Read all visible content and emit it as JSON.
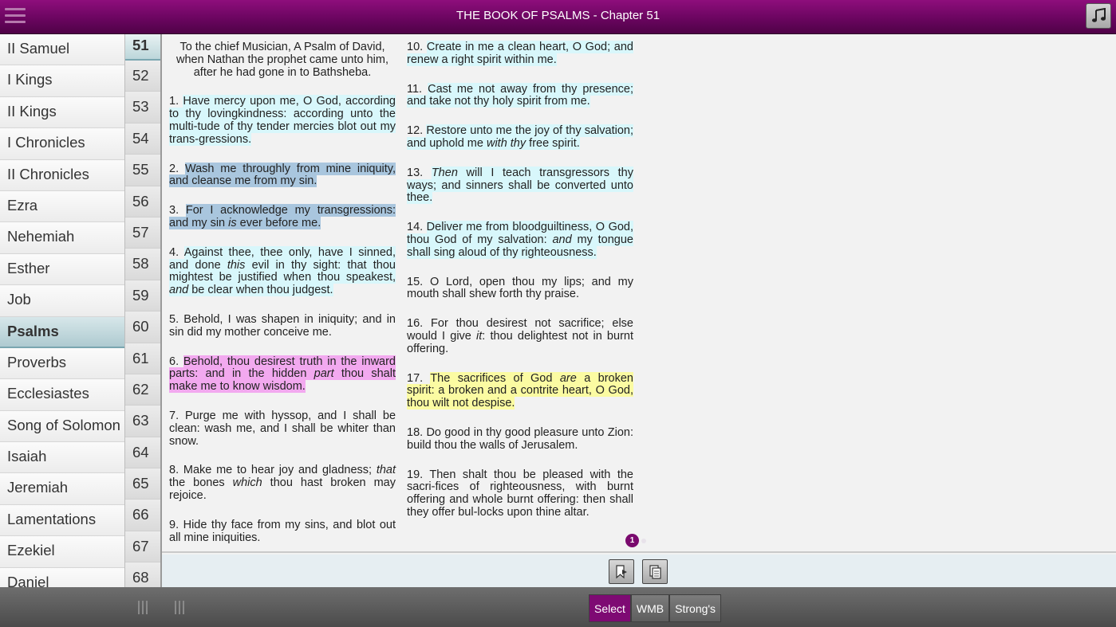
{
  "header": {
    "title": "THE BOOK OF PSALMS - Chapter 51"
  },
  "books": [
    {
      "label": "II Samuel"
    },
    {
      "label": "I Kings"
    },
    {
      "label": "II Kings"
    },
    {
      "label": "I Chronicles"
    },
    {
      "label": "II Chronicles"
    },
    {
      "label": "Ezra"
    },
    {
      "label": "Nehemiah"
    },
    {
      "label": "Esther"
    },
    {
      "label": "Job"
    },
    {
      "label": "Psalms",
      "selected": true
    },
    {
      "label": "Proverbs"
    },
    {
      "label": "Ecclesiastes"
    },
    {
      "label": "Song of Solomon"
    },
    {
      "label": "Isaiah"
    },
    {
      "label": "Jeremiah"
    },
    {
      "label": "Lamentations"
    },
    {
      "label": "Ezekiel"
    },
    {
      "label": "Daniel"
    }
  ],
  "chapters": [
    "51",
    "52",
    "53",
    "54",
    "55",
    "56",
    "57",
    "58",
    "59",
    "60",
    "61",
    "62",
    "63",
    "64",
    "65",
    "66",
    "67",
    "68"
  ],
  "selected_chapter": "51",
  "reader": {
    "intro": "To the chief Musician, A Psalm of David, when Nathan the prophet came unto him, after he had gone in to Bathsheba.",
    "verses": {
      "v1": {
        "num": "1.",
        "text": "Have mercy upon me, O God, according to thy lovingkindness: according unto the multi-tude of thy tender mercies blot out my trans-gressions."
      },
      "v2": {
        "num": "2.",
        "text": "Wash me throughly from mine iniquity, and cleanse me from my sin."
      },
      "v3": {
        "num": "3.",
        "a": "For I acknowledge my transgressions: and my sin ",
        "b": "is",
        "c": " ever before me."
      },
      "v4": {
        "num": "4.",
        "a": "Against thee, thee only, have I sinned, and done ",
        "b": "this",
        "c": " evil in thy sight: that thou mightest be justified when thou speakest, ",
        "d": "and",
        "e": " be clear when thou judgest."
      },
      "v5": {
        "num": "5.",
        "a": "Behold, I was shapen in iniquity; and in sin did my mother conceive me."
      },
      "v6": {
        "num": "6.",
        "a": "Behold, thou desirest truth in the inward parts: and in the hidden ",
        "b": "part",
        "c": " thou shalt make me to know wisdom."
      },
      "v7": {
        "num": "7.",
        "a": "Purge me with hyssop, and I shall be clean: wash me, and I shall be whiter than snow."
      },
      "v8": {
        "num": "8.",
        "a": "Make me to hear joy and gladness; ",
        "b": "that",
        "c": " the bones ",
        "d": "which",
        "e": " thou hast broken may rejoice."
      },
      "v9": {
        "num": "9.",
        "a": "Hide thy face from my sins, and blot out all mine iniquities."
      },
      "v10": {
        "num": "10.",
        "a": "Create in me a clean heart, O God; and renew a right spirit within me."
      },
      "v11": {
        "num": "11.",
        "a": "Cast me not away from thy presence; and take not thy holy spirit from me."
      },
      "v12": {
        "num": "12.",
        "a": "Restore unto me the joy of thy salvation; and uphold me ",
        "b": "with thy",
        "c": " free spirit."
      },
      "v13": {
        "num": "13.",
        "b": "Then",
        "c": " will I teach transgressors thy ways; and sinners shall be converted unto thee."
      },
      "v14": {
        "num": "14.",
        "a": "Deliver me from bloodguiltiness, O God, thou God of my salvation: ",
        "b": "and",
        "c": " my tongue shall sing aloud of thy righteousness."
      },
      "v15": {
        "num": "15.",
        "a": "O Lord, open thou my lips; and my mouth shall shew forth thy praise."
      },
      "v16": {
        "num": "16.",
        "a": "For thou desirest not sacrifice; else would I give ",
        "b": "it",
        "c": ": thou delightest not in burnt offering."
      },
      "v17": {
        "num": "17.",
        "a": "The sacrifices of God ",
        "b": "are",
        "c": " a broken spirit: a broken and a contrite heart, O God, thou wilt not despise."
      },
      "v18": {
        "num": "18.",
        "a": "Do good in thy good pleasure unto Zion: build thou the walls of Jerusalem."
      },
      "v19": {
        "num": "19.",
        "a": "Then shalt thou be pleased with the sacri-fices of righteousness, with burnt offering and whole burnt offering: then shall they offer bul-locks upon thine altar."
      }
    },
    "page_indicator": "1"
  },
  "highlight_colors": {
    "cyan": "#d8f7fb",
    "blue": "#a9c6de",
    "pink": "#f2a9ef",
    "yellow": "#fbfba2"
  },
  "icons": {
    "menu": "hamburger-icon",
    "music": "music-note-icon",
    "bookmark": "bookmark-icon",
    "copy": "copy-icon"
  },
  "bottombar": {
    "select_label": "Select",
    "wmb_label": "WMB",
    "strongs_label": "Strong's"
  }
}
